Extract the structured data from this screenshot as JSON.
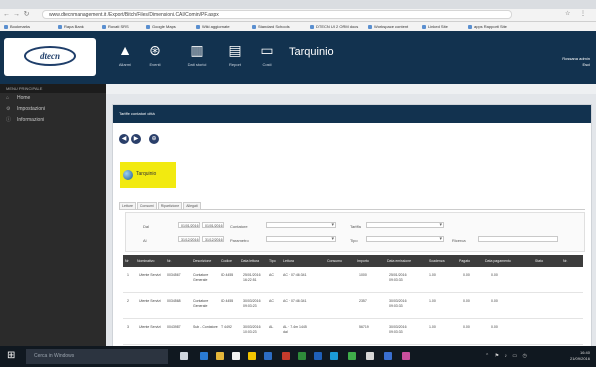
{
  "browser": {
    "url": "www.dtecnmanagement.it /Export/Bitch/Files/Dimensioni.CAI/Comin/PF.aspx",
    "win_icons": [
      "☆",
      "⋮"
    ],
    "bookmarks": [
      "Bookmarks",
      "Rapa Bank",
      "Rovati  SRS",
      "Google Maps",
      "Wiki aggiornate",
      "Standard Schools",
      "DTECN  UI 2 ORM docs",
      "Workspace content",
      "Linked Site",
      "apps Rapporti Site"
    ]
  },
  "header": {
    "logo_text": "dtecn",
    "title": "Tarquinio",
    "icons": [
      {
        "glyph": "▲",
        "label": "Allarmi",
        "name": "alarm-icon"
      },
      {
        "glyph": "⊛",
        "label": "Eventi",
        "name": "lifebuoy-icon"
      },
      {
        "glyph": "▥",
        "label": "Dati storici",
        "name": "history-icon"
      },
      {
        "glyph": "▤",
        "label": "Report",
        "name": "report-icon"
      },
      {
        "glyph": "▭",
        "label": "Costi",
        "name": "card-icon"
      }
    ],
    "user": {
      "name": "Rossana admin",
      "logout": "Esci"
    }
  },
  "sidebar": {
    "heading": "MENU PRINCIPALE",
    "items": [
      {
        "icon": "⌂",
        "label": "Home"
      },
      {
        "icon": "⚙",
        "label": "Impostazioni"
      },
      {
        "icon": "ⓘ",
        "label": "Informazioni"
      }
    ]
  },
  "panel": {
    "title": "Tariffe contatori città",
    "buttons": [
      "◀",
      "▶",
      "⊕"
    ],
    "tile_label": "Tarquinio",
    "subtabs": [
      "Letture",
      "Consumi",
      "Ripartizione",
      "Allegati"
    ]
  },
  "filters": {
    "dal_label": "Dal",
    "dal_value": "01/01/2016",
    "al_label": "Al",
    "al_value": "31/12/2016",
    "from_time": "01/01/2016",
    "to_time": "31/12/2016",
    "contatore_label": "Contatore",
    "parametro_label": "Parametro",
    "tariffa_label": "Tariffa",
    "tipo_label": "Tipo",
    "ricerca_label": "Ricerca"
  },
  "grid": {
    "columns": [
      "Nr",
      "Nominativo",
      "Nr.",
      "Descrizione",
      "Codice",
      "Data lettura",
      "Tipo",
      "Lettura",
      "Consumo",
      "Importo",
      "Data emissione",
      "Scadenza",
      "Pagato",
      "Data pagamento",
      "Stato",
      "Nr."
    ],
    "rows": [
      [
        "1",
        "Utente Servizi",
        "0034567",
        "Contatore Generale",
        "ID 4455",
        "25/01/2016 16:22:51",
        "AC",
        "AC · 07:46:341",
        "",
        "1000",
        "25/01/2016 09:03:33",
        "1.00",
        "0.00",
        "0.00"
      ],
      [
        "2",
        "Utente Servizi",
        "0034568",
        "Contatore Generale",
        "ID 4455",
        "30/03/2016 09:03:23",
        "AC",
        "AC · 07:46:341",
        "",
        "2357",
        "30/03/2016 09:03:33",
        "1.00",
        "0.00",
        "0.00"
      ],
      [
        "3",
        "Utente Servizi",
        "0043987",
        "Sub - Contatore",
        "T 4492",
        "30/03/2016 10:03:23",
        "AL",
        "AL · 7.4m 1445 dal",
        "",
        "56719",
        "30/03/2016 09:03:33",
        "1.00",
        "0.00",
        "0.00"
      ]
    ]
  },
  "taskbar": {
    "search_placeholder": "Cerca in Windows",
    "time": "16:40",
    "date": "21/09/2016",
    "tray_glyphs": "⌃ ⚑ ♪ ▭ ◷"
  }
}
